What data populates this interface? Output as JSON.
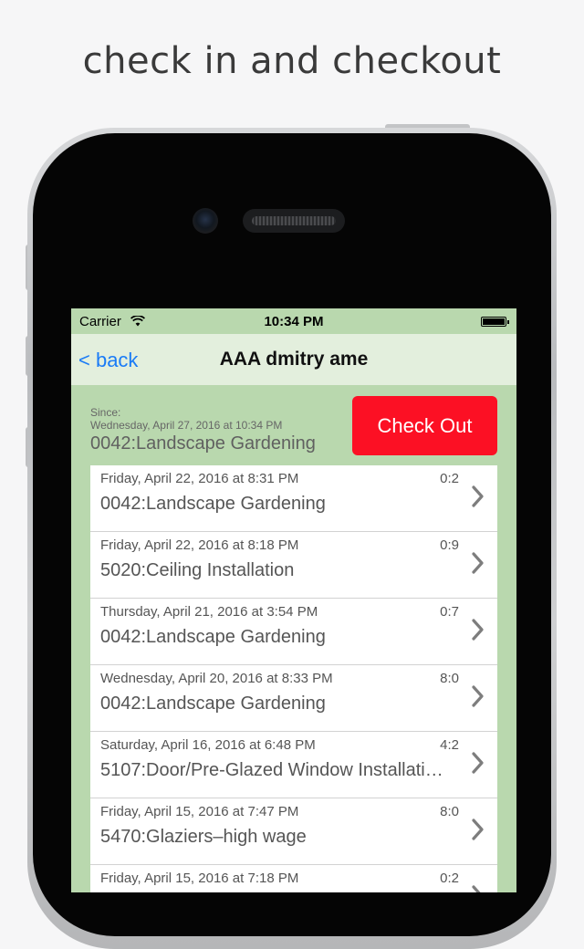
{
  "caption": "check in and checkout",
  "status_bar": {
    "carrier": "Carrier",
    "time": "10:34 PM"
  },
  "nav": {
    "back_label": "< back",
    "title": "AAA dmitry ame"
  },
  "checkin": {
    "since_label": "Since:",
    "since_date": "Wednesday, April 27, 2016 at 10:34 PM",
    "job": "0042:Landscape Gardening",
    "checkout_label": "Check Out"
  },
  "colors": {
    "screen_background": "#b9d8ae",
    "navbar": "#e3efdd",
    "checkout_button": "#fc1024",
    "back_link": "#1a7bf6"
  },
  "entries": [
    {
      "date": "Friday, April 22, 2016 at 8:31 PM",
      "duration": "0:2",
      "job": "0042:Landscape Gardening"
    },
    {
      "date": "Friday, April 22, 2016 at 8:18 PM",
      "duration": "0:9",
      "job": "5020:Ceiling Installation"
    },
    {
      "date": "Thursday, April 21, 2016 at 3:54 PM",
      "duration": "0:7",
      "job": "0042:Landscape Gardening"
    },
    {
      "date": "Wednesday, April 20, 2016 at 8:33 PM",
      "duration": "8:0",
      "job": "0042:Landscape Gardening"
    },
    {
      "date": "Saturday, April 16, 2016 at 6:48 PM",
      "duration": "4:2",
      "job": "5107:Door/Pre-Glazed Window Installati…"
    },
    {
      "date": "Friday, April 15, 2016 at 7:47 PM",
      "duration": "8:0",
      "job": "5470:Glaziers–high wage"
    },
    {
      "date": "Friday, April 15, 2016 at 7:18 PM",
      "duration": "0:2",
      "job": ""
    }
  ],
  "icons": {
    "wifi": "wifi-icon",
    "battery": "battery-icon",
    "chevron": "chevron-right-icon"
  }
}
